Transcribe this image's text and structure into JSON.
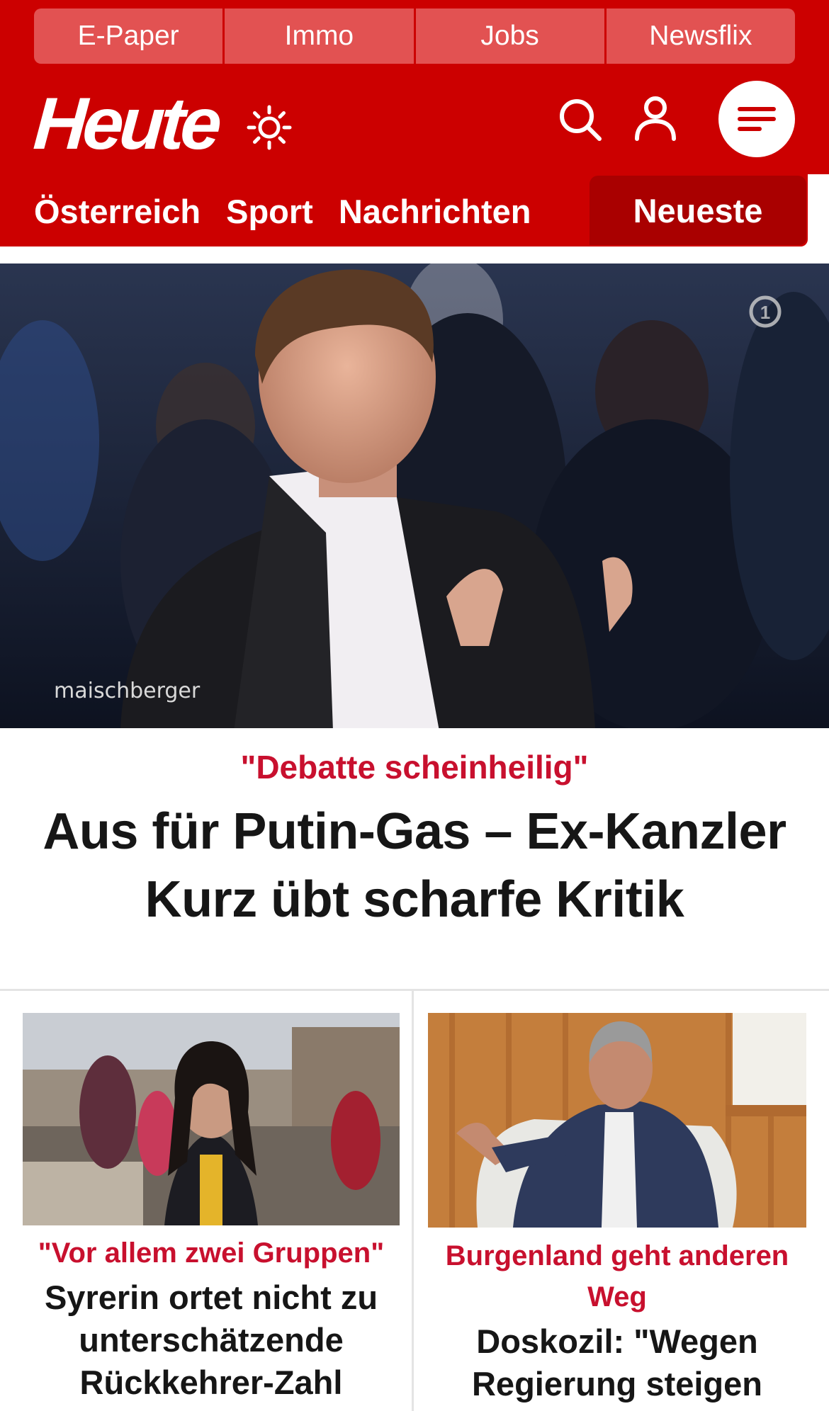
{
  "service_tabs": [
    "E-Paper",
    "Immo",
    "Jobs",
    "Newsflix"
  ],
  "logo": "Heute",
  "nav": {
    "items": [
      "Österreich",
      "Sport",
      "Nachrichten"
    ],
    "active": "Neueste"
  },
  "hero": {
    "image_watermark": "maischberger",
    "kicker": "\"Debatte scheinheilig\"",
    "headline": "Aus für Putin-Gas – Ex-Kanzler Kurz übt scharfe Kritik"
  },
  "cards": [
    {
      "kicker": "\"Vor allem zwei Gruppen\"",
      "title": "Syrerin ortet nicht zu unterschätzende Rückkehrer-Zahl"
    },
    {
      "kicker": "Burgenland geht anderen Weg",
      "title": "Doskozil: \"Wegen Regierung steigen"
    }
  ],
  "colors": {
    "brand_red": "#cc0000",
    "nav_active": "#a90000",
    "service_tab": "#e25252",
    "kicker_red": "#c8102e"
  }
}
